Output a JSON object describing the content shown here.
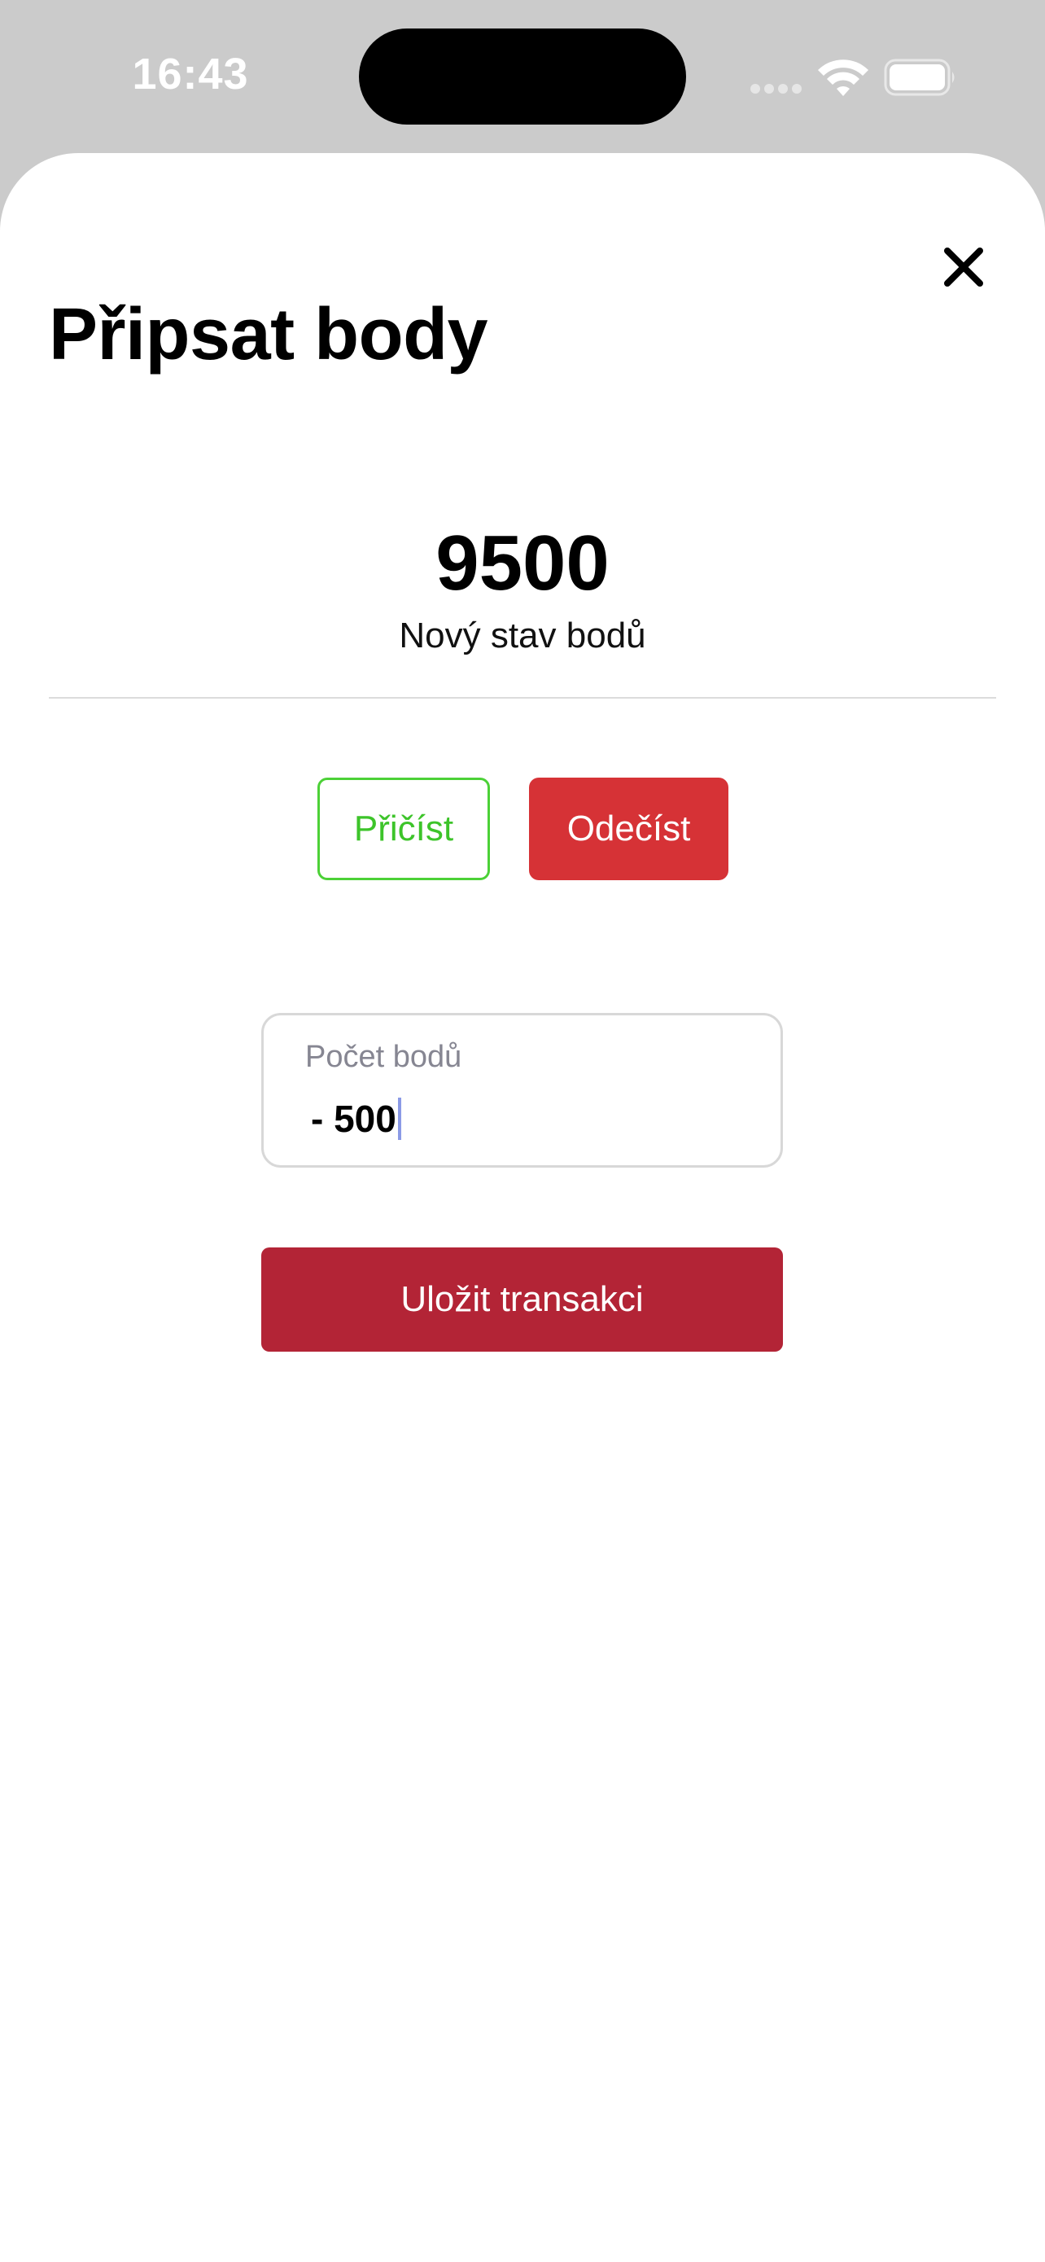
{
  "status_bar": {
    "time": "16:43"
  },
  "sheet": {
    "title": "Připsat body",
    "close_icon": "close-icon"
  },
  "balance": {
    "value": "9500",
    "label": "Nový stav bodů"
  },
  "mode_toggle": {
    "add_label": "Přičíst",
    "subtract_label": "Odečíst",
    "selected": "subtract"
  },
  "points_input": {
    "label": "Počet bodů",
    "value": "- 500"
  },
  "save_button": {
    "label": "Uložit transakci"
  },
  "colors": {
    "add_green": "#3dc42a",
    "subtract_red": "#d63236",
    "save_red": "#b32436"
  }
}
